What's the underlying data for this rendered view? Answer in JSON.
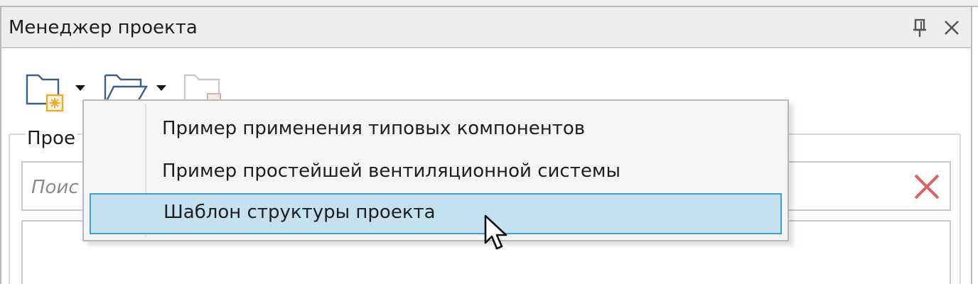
{
  "panel": {
    "title": "Менеджер проекта"
  },
  "toolbar": {
    "buttons": [
      {
        "icon": "new-project-folder-icon"
      },
      {
        "icon": "open-project-folder-icon"
      },
      {
        "icon": "disabled-folder-icon"
      }
    ]
  },
  "project_group": {
    "label": "Прое"
  },
  "search": {
    "placeholder": "Поис"
  },
  "dropdown": {
    "items": [
      {
        "label": "Пример применения типовых компонентов"
      },
      {
        "label": "Пример простейшей вентиляционной системы"
      },
      {
        "label": "Шаблон структуры проекта",
        "highlighted": true
      }
    ]
  },
  "colors": {
    "highlight_bg": "#c5e1ef",
    "highlight_border": "#3e9fd6",
    "clear_icon": "#e06060",
    "folder_star": "#f5a623"
  }
}
